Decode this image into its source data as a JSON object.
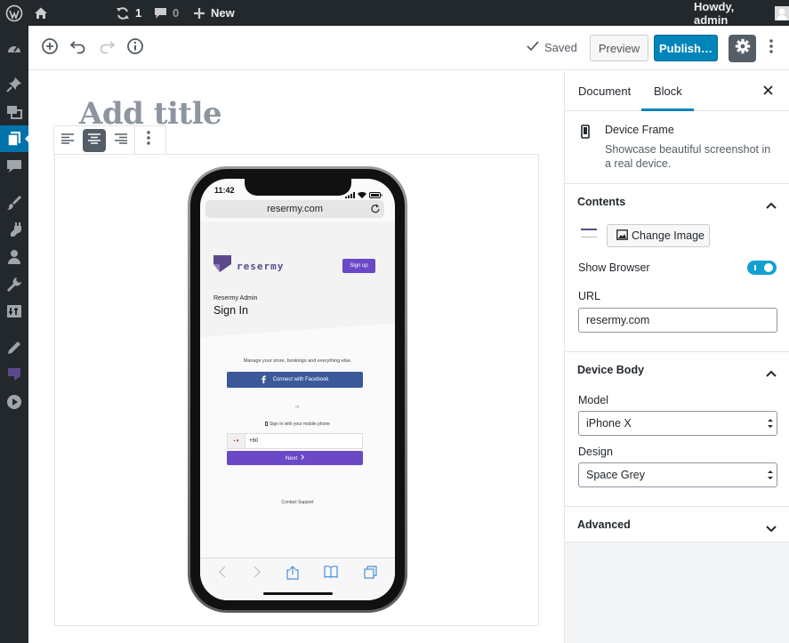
{
  "adminbar": {
    "updates_count": "1",
    "comments_count": "0",
    "new_label": "New",
    "howdy": "Howdy, admin"
  },
  "header": {
    "saved_label": "Saved",
    "preview_label": "Preview",
    "publish_label": "Publish…"
  },
  "editor": {
    "title_placeholder": "Add title"
  },
  "device": {
    "time": "11:42",
    "url": "resermy.com",
    "logo_text": "resermy",
    "signup_label": "Sign up",
    "subtitle": "Resermy Admin",
    "heading": "Sign In",
    "manage_text": "Manage your store, bookings and everything else.",
    "facebook_label": "Connect with Facebook",
    "or_text": "or",
    "phone_signin_text": "Sign in with your mobile phone",
    "phone_prefix": "+60",
    "next_label": "Next",
    "contact_text": "Contact Support"
  },
  "sidebar": {
    "tabs": [
      {
        "label": "Document"
      },
      {
        "label": "Block"
      }
    ],
    "active_tab": "Block",
    "block": {
      "title": "Device Frame",
      "description": "Showcase beautiful screenshot in a real device."
    },
    "contents": {
      "title": "Contents",
      "change_image_label": "Change Image",
      "show_browser_label": "Show Browser",
      "show_browser_on": true,
      "url_label": "URL",
      "url_value": "resermy.com"
    },
    "device_body": {
      "title": "Device Body",
      "model_label": "Model",
      "model_value": "iPhone X",
      "design_label": "Design",
      "design_value": "Space Grey"
    },
    "advanced": {
      "title": "Advanced"
    }
  },
  "colors": {
    "admin_bar": "#23282d",
    "accent": "#0085ba",
    "toggle_on": "#11a0d2",
    "brand_purple": "#6b48c6",
    "facebook": "#3b5998"
  }
}
